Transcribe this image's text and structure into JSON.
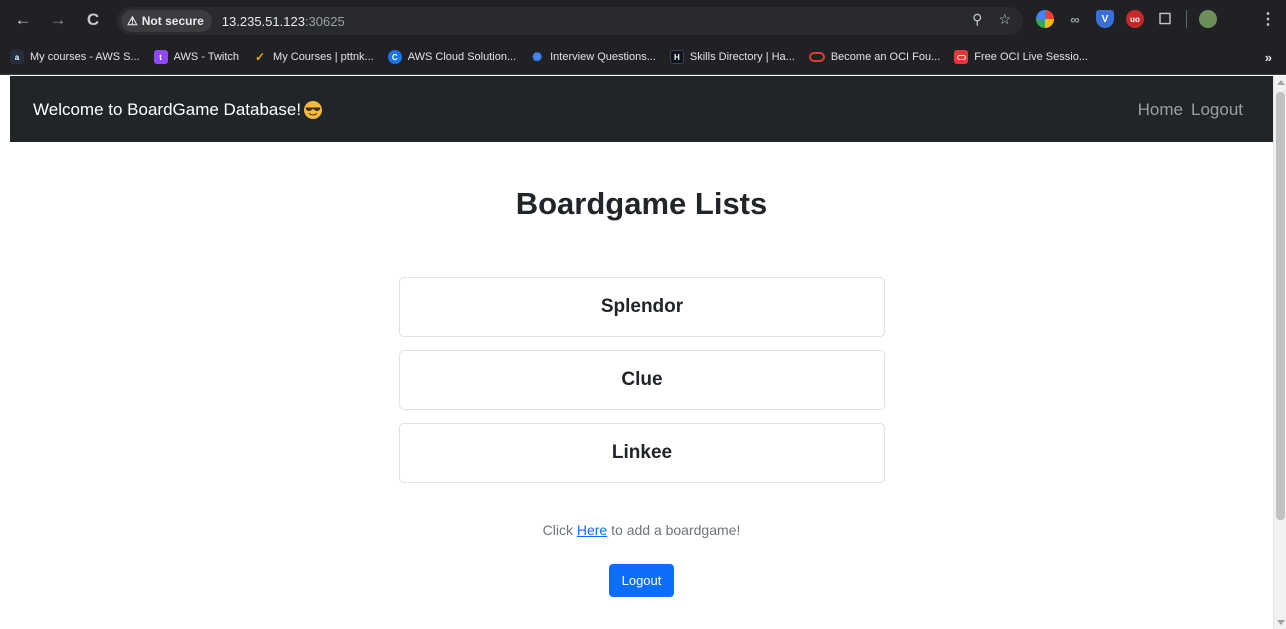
{
  "browser": {
    "security_label": "Not secure",
    "url_host": "13.235.51.123",
    "url_port": ":30625",
    "bookmarks": [
      {
        "label": "My courses - AWS S...",
        "icon": "aws-icon",
        "color": "#232f3e"
      },
      {
        "label": "AWS - Twitch",
        "icon": "twitch-icon",
        "color": "#9146ff"
      },
      {
        "label": "My Courses | pttnk...",
        "icon": "course-icon",
        "color": "#f2a900"
      },
      {
        "label": "AWS Cloud Solution...",
        "icon": "c-icon",
        "color": "#1a73e8"
      },
      {
        "label": "Interview Questions...",
        "icon": "star-icon",
        "color": "#4285f4"
      },
      {
        "label": "Skills Directory | Ha...",
        "icon": "hackerrank-icon",
        "color": "#0e141e"
      },
      {
        "label": "Become an OCI Fou...",
        "icon": "oracle-icon",
        "color": "#c74634"
      },
      {
        "label": "Free OCI Live Sessio...",
        "icon": "oracle-icon",
        "color": "#c74634"
      }
    ]
  },
  "navbar": {
    "brand": "Welcome to BoardGame Database!",
    "links": [
      "Home",
      "Logout"
    ]
  },
  "main": {
    "title": "Boardgame Lists",
    "games": [
      "Splendor",
      "Clue",
      "Linkee"
    ],
    "add_prefix": "Click ",
    "add_link": "Here",
    "add_suffix": " to add a boardgame!",
    "logout_button": "Logout"
  }
}
